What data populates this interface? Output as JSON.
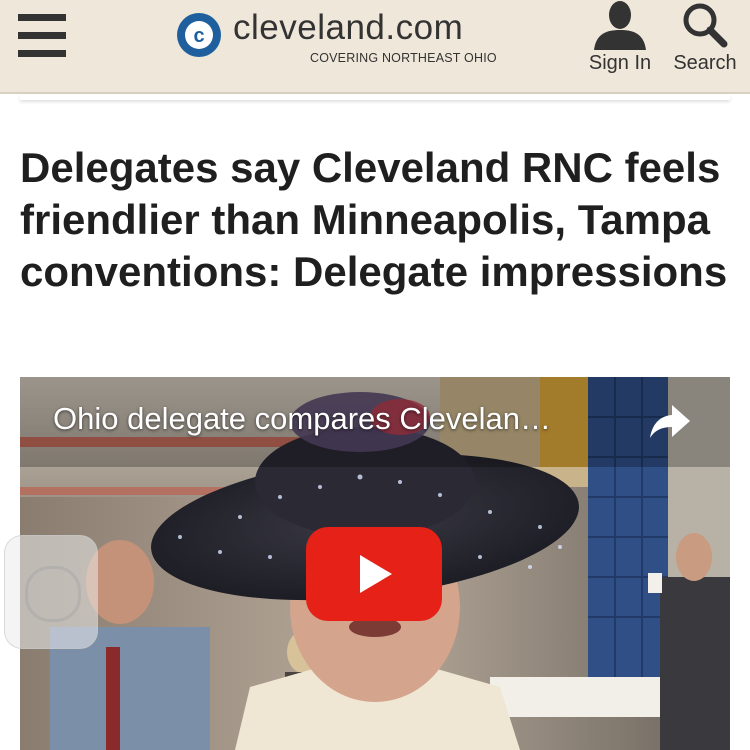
{
  "header": {
    "brand_name": "cleveland.com",
    "brand_tagline": "COVERING NORTHEAST OHIO",
    "logo_letter": "c",
    "sign_in_label": "Sign In",
    "search_label": "Search",
    "menu_icon": "hamburger-menu-icon",
    "user_icon": "user-silhouette-icon",
    "search_icon": "magnifier-icon"
  },
  "article": {
    "headline": "Delegates say Cleveland RNC feels friendlier than Minneapolis, Tampa conventions: Delegate impressions"
  },
  "video": {
    "title": "Ohio delegate compares Clevelan…",
    "share_icon": "share-arrow-icon",
    "play_icon": "youtube-play-icon"
  },
  "colors": {
    "header_bg": "#efe7da",
    "text_dark": "#1f1f1f",
    "logo_blue": "#1f5f9e",
    "play_red": "#e62117"
  }
}
